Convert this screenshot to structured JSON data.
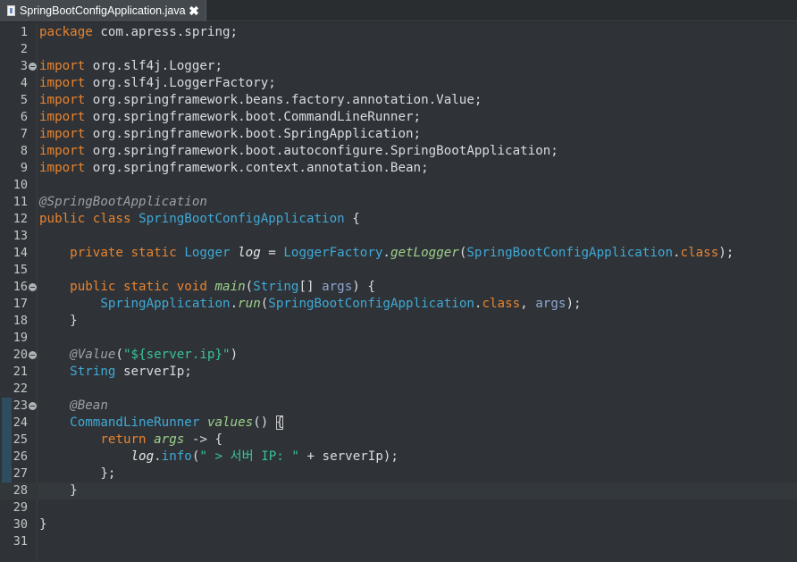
{
  "tab": {
    "filename": "SpringBootConfigApplication.java",
    "close_glyph": "✖"
  },
  "editor": {
    "lines": [
      {
        "n": "1",
        "tokens": [
          [
            "kw",
            "package"
          ],
          [
            "pkg",
            " com.apress.spring;"
          ]
        ]
      },
      {
        "n": "2",
        "tokens": []
      },
      {
        "n": "3",
        "fold": true,
        "tokens": [
          [
            "kw",
            "import"
          ],
          [
            "pkg",
            " org.slf4j.Logger;"
          ]
        ]
      },
      {
        "n": "4",
        "tokens": [
          [
            "kw",
            "import"
          ],
          [
            "pkg",
            " org.slf4j.LoggerFactory;"
          ]
        ]
      },
      {
        "n": "5",
        "tokens": [
          [
            "kw",
            "import"
          ],
          [
            "pkg",
            " org.springframework.beans.factory.annotation.Value;"
          ]
        ]
      },
      {
        "n": "6",
        "tokens": [
          [
            "kw",
            "import"
          ],
          [
            "pkg",
            " org.springframework.boot.CommandLineRunner;"
          ]
        ]
      },
      {
        "n": "7",
        "tokens": [
          [
            "kw",
            "import"
          ],
          [
            "pkg",
            " org.springframework.boot.SpringApplication;"
          ]
        ]
      },
      {
        "n": "8",
        "tokens": [
          [
            "kw",
            "import"
          ],
          [
            "pkg",
            " org.springframework.boot.autoconfigure.SpringBootApplication;"
          ]
        ]
      },
      {
        "n": "9",
        "tokens": [
          [
            "kw",
            "import"
          ],
          [
            "pkg",
            " org.springframework.context.annotation.Bean;"
          ]
        ]
      },
      {
        "n": "10",
        "tokens": []
      },
      {
        "n": "11",
        "tokens": [
          [
            "ann",
            "@SpringBootApplication"
          ]
        ]
      },
      {
        "n": "12",
        "tokens": [
          [
            "kw",
            "public"
          ],
          [
            "pkg",
            " "
          ],
          [
            "kw",
            "class"
          ],
          [
            "pkg",
            " "
          ],
          [
            "type",
            "SpringBootConfigApplication"
          ],
          [
            "pkg",
            " {"
          ]
        ]
      },
      {
        "n": "13",
        "tokens": []
      },
      {
        "n": "14",
        "tokens": [
          [
            "pkg",
            "    "
          ],
          [
            "kw",
            "private"
          ],
          [
            "pkg",
            " "
          ],
          [
            "kw",
            "static"
          ],
          [
            "pkg",
            " "
          ],
          [
            "type",
            "Logger"
          ],
          [
            "pkg",
            " "
          ],
          [
            "fld",
            "log"
          ],
          [
            "pkg",
            " = "
          ],
          [
            "type",
            "LoggerFactory"
          ],
          [
            "pkg",
            "."
          ],
          [
            "mth2",
            "getLogger"
          ],
          [
            "pkg",
            "("
          ],
          [
            "type",
            "SpringBootConfigApplication"
          ],
          [
            "pkg",
            "."
          ],
          [
            "kw",
            "class"
          ],
          [
            "pkg",
            ");"
          ]
        ]
      },
      {
        "n": "15",
        "tokens": []
      },
      {
        "n": "16",
        "fold": true,
        "tokens": [
          [
            "pkg",
            "    "
          ],
          [
            "kw",
            "public"
          ],
          [
            "pkg",
            " "
          ],
          [
            "kw",
            "static"
          ],
          [
            "pkg",
            " "
          ],
          [
            "kw",
            "void"
          ],
          [
            "pkg",
            " "
          ],
          [
            "mth2",
            "main"
          ],
          [
            "pkg",
            "("
          ],
          [
            "type",
            "String"
          ],
          [
            "pkg",
            "[] "
          ],
          [
            "par",
            "args"
          ],
          [
            "pkg",
            ") {"
          ]
        ]
      },
      {
        "n": "17",
        "tokens": [
          [
            "pkg",
            "        "
          ],
          [
            "type",
            "SpringApplication"
          ],
          [
            "pkg",
            "."
          ],
          [
            "mth2",
            "run"
          ],
          [
            "pkg",
            "("
          ],
          [
            "type",
            "SpringBootConfigApplication"
          ],
          [
            "pkg",
            "."
          ],
          [
            "kw",
            "class"
          ],
          [
            "pkg",
            ", "
          ],
          [
            "par",
            "args"
          ],
          [
            "pkg",
            ");"
          ]
        ]
      },
      {
        "n": "18",
        "tokens": [
          [
            "pkg",
            "    }"
          ]
        ]
      },
      {
        "n": "19",
        "tokens": []
      },
      {
        "n": "20",
        "fold": true,
        "tokens": [
          [
            "pkg",
            "    "
          ],
          [
            "ann",
            "@Value"
          ],
          [
            "pkg",
            "("
          ],
          [
            "str",
            "\"${server.ip}\""
          ],
          [
            "pkg",
            ")"
          ]
        ]
      },
      {
        "n": "21",
        "tokens": [
          [
            "pkg",
            "    "
          ],
          [
            "type",
            "String"
          ],
          [
            "pkg",
            " serverIp;"
          ]
        ]
      },
      {
        "n": "22",
        "tokens": []
      },
      {
        "n": "23",
        "fold": true,
        "tokens": [
          [
            "pkg",
            "    "
          ],
          [
            "ann",
            "@Bean"
          ]
        ]
      },
      {
        "n": "24",
        "tokens": [
          [
            "pkg",
            "    "
          ],
          [
            "type",
            "CommandLineRunner"
          ],
          [
            "pkg",
            " "
          ],
          [
            "mth2",
            "values"
          ],
          [
            "pkg",
            "() "
          ],
          [
            "bracket",
            "{"
          ]
        ]
      },
      {
        "n": "25",
        "tokens": [
          [
            "pkg",
            "        "
          ],
          [
            "kw",
            "return"
          ],
          [
            "pkg",
            " "
          ],
          [
            "mth2",
            "args"
          ],
          [
            "pkg",
            " -> {"
          ]
        ]
      },
      {
        "n": "26",
        "tokens": [
          [
            "pkg",
            "            "
          ],
          [
            "fld",
            "log"
          ],
          [
            "pkg",
            "."
          ],
          [
            "type",
            "info"
          ],
          [
            "pkg",
            "("
          ],
          [
            "str",
            "\" > 서버 IP: \""
          ],
          [
            "pkg",
            " + serverIp);"
          ]
        ]
      },
      {
        "n": "27",
        "tokens": [
          [
            "pkg",
            "        };"
          ]
        ]
      },
      {
        "n": "28",
        "current": true,
        "tokens": [
          [
            "pkg",
            "    }"
          ]
        ]
      },
      {
        "n": "29",
        "tokens": []
      },
      {
        "n": "30",
        "tokens": [
          [
            "pkg",
            "}"
          ]
        ]
      },
      {
        "n": "31",
        "tokens": []
      }
    ]
  },
  "colors": {
    "background": "#2f3337",
    "keyword": "#e8832f",
    "type": "#3fa9d6",
    "string": "#39c19b",
    "annotation": "#9aa1a6",
    "change_bar": "#2f4d61"
  }
}
